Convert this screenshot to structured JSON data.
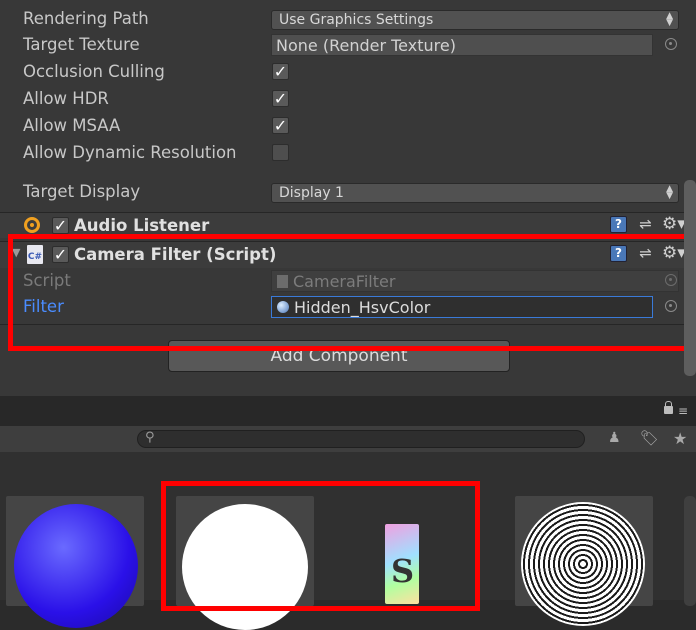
{
  "camera": {
    "rendering_path": {
      "label": "Rendering Path",
      "value": "Use Graphics Settings"
    },
    "target_texture": {
      "label": "Target Texture",
      "value": "None (Render Texture)"
    },
    "occlusion_culling": {
      "label": "Occlusion Culling",
      "checked": true
    },
    "allow_hdr": {
      "label": "Allow HDR",
      "checked": true
    },
    "allow_msaa": {
      "label": "Allow MSAA",
      "checked": true
    },
    "allow_dynamic_resolution": {
      "label": "Allow Dynamic Resolution",
      "checked": false
    },
    "target_display": {
      "label": "Target Display",
      "value": "Display 1"
    }
  },
  "audio_listener": {
    "title": "Audio Listener",
    "enabled": true
  },
  "camera_filter": {
    "title": "Camera Filter (Script)",
    "enabled": true,
    "script_label": "Script",
    "script_value": "CameraFilter",
    "filter_label": "Filter",
    "filter_value": "Hidden_HsvColor"
  },
  "add_component_label": "Add Component",
  "project": {
    "search": {
      "placeholder": ""
    }
  },
  "colors": {
    "highlight": "#ff0000",
    "link_label": "#4a8cff"
  }
}
